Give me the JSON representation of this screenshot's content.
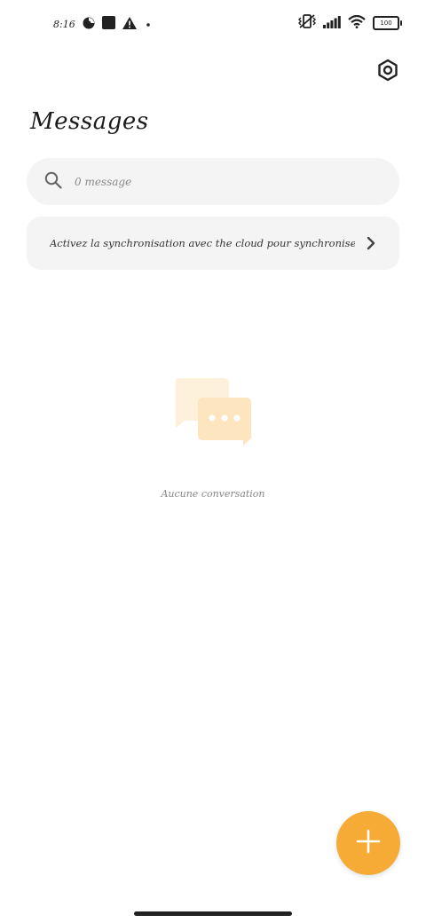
{
  "status_bar": {
    "time": "8:16",
    "battery": "100",
    "icons": [
      "data-saver-icon",
      "square-notification-icon",
      "warning-icon",
      "dot-icon",
      "vibrate-off-icon",
      "signal-icon",
      "wifi-icon",
      "battery-icon"
    ]
  },
  "header": {
    "title": "Messages",
    "settings_icon": "hexagon-settings-icon"
  },
  "search": {
    "placeholder": "0 message",
    "value": ""
  },
  "sync_banner": {
    "text": "Activez la synchronisation avec the cloud pour synchroniser"
  },
  "empty_state": {
    "text": "Aucune conversation",
    "illustration": "chat-bubbles-icon"
  },
  "fab": {
    "icon": "plus-icon",
    "color": "#f5ab35"
  },
  "colors": {
    "background": "#ffffff",
    "surface": "#f4f4f4",
    "accent": "#f5ab35",
    "empty_illustration_light": "#fdf1dc",
    "empty_illustration_dark": "#fde6bf"
  }
}
